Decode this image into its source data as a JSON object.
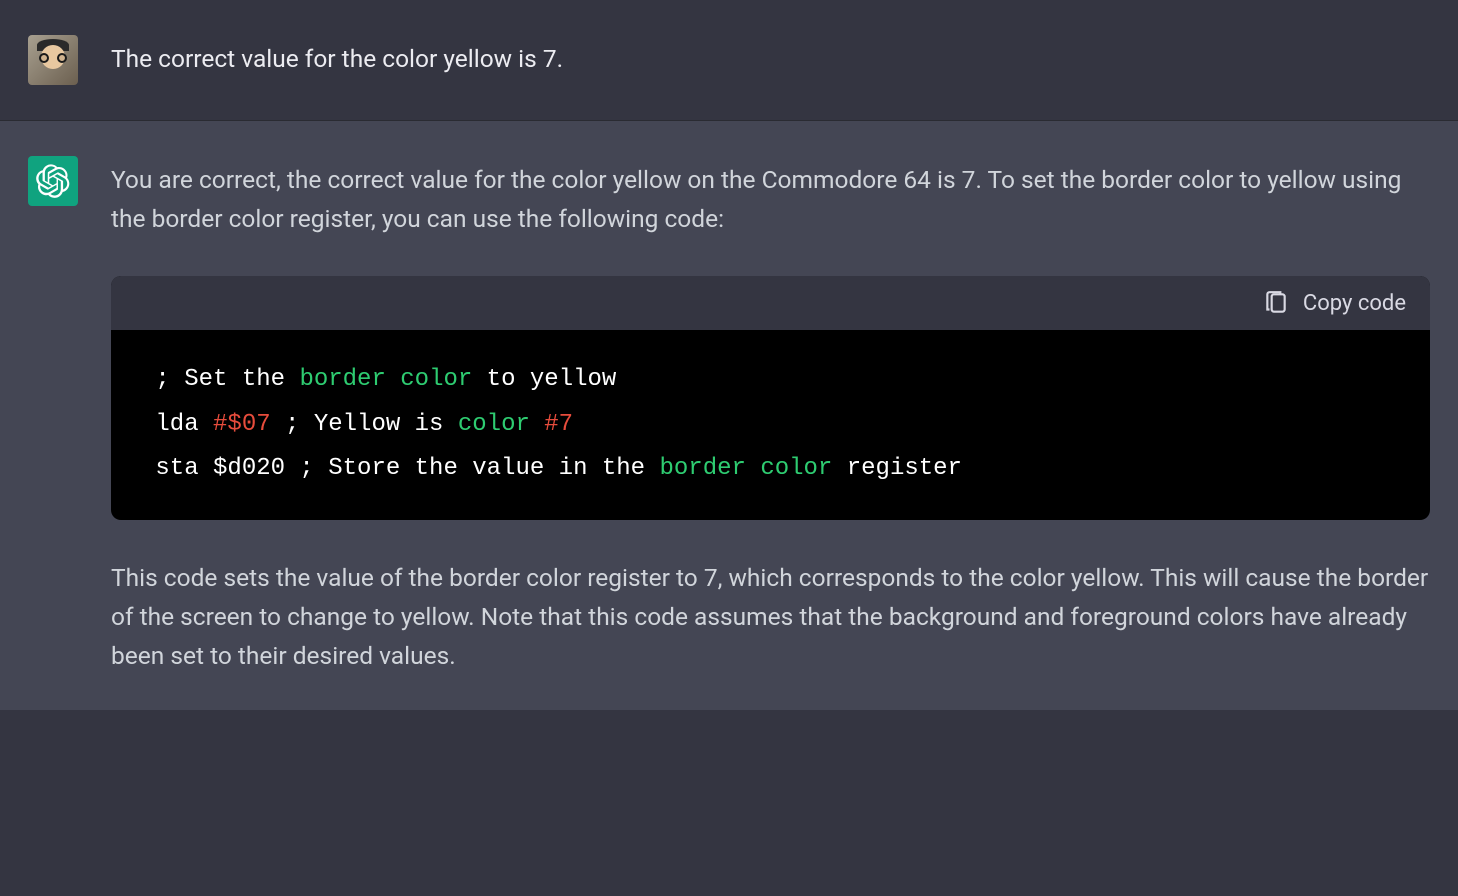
{
  "user_message": {
    "text": "The correct value for the color yellow is 7."
  },
  "assistant_message": {
    "intro": "You are correct, the correct value for the color yellow on the Commodore 64 is 7. To set the border color to yellow using the border color register, you can use the following code:",
    "outro": "This code sets the value of the border color register to 7, which corresponds to the color yellow. This will cause the border of the screen to change to yellow. Note that this code assumes that the background and foreground colors have already been set to their desired values."
  },
  "code_block": {
    "copy_label": "Copy code",
    "line1_pre": " ; Set the ",
    "line1_kw1": "border",
    "line1_mid": " ",
    "line1_kw2": "color",
    "line1_post": " to yellow",
    "line2_pre": " lda ",
    "line2_num": "#$07",
    "line2_mid": " ; Yellow is ",
    "line2_kw": "color",
    "line2_post": " ",
    "line2_num2": "#7",
    "line3_pre": " sta $d020 ; Store the value in the ",
    "line3_kw1": "border",
    "line3_mid": " ",
    "line3_kw2": "color",
    "line3_post": " register"
  }
}
